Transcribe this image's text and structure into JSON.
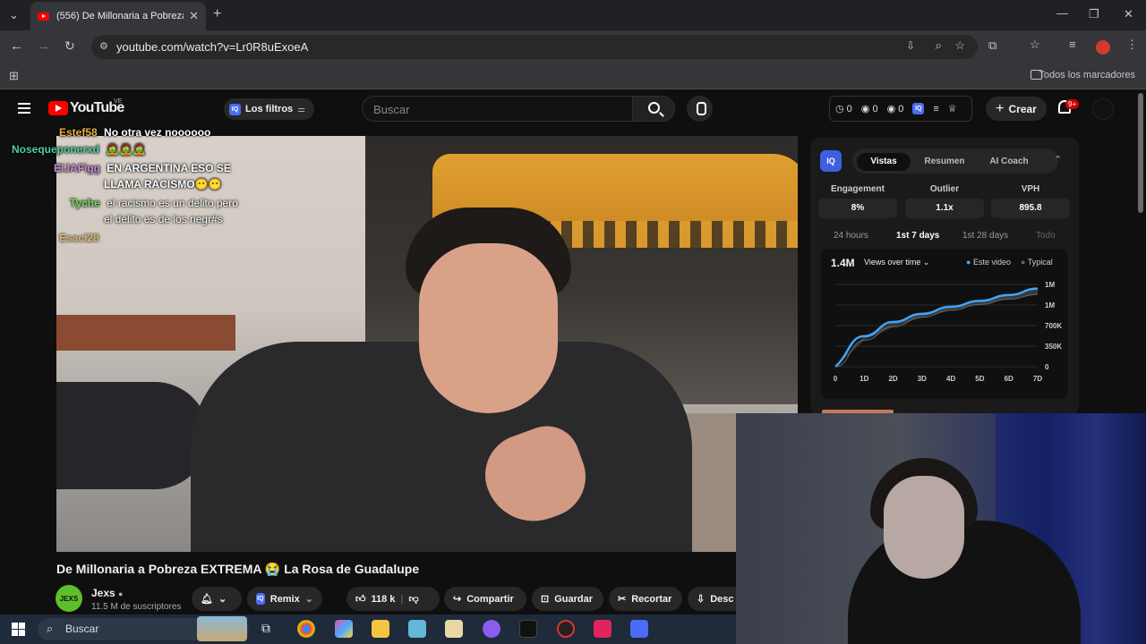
{
  "browser": {
    "tab_title": "(556) De Millonaria a Pobreza E",
    "url": "youtube.com/watch?v=Lr0R8uExoeA",
    "bookmarks_label": "Todos los marcadores"
  },
  "youtube": {
    "logo_text": "YouTube",
    "region": "VE",
    "filters_label": "Los filtros",
    "search_placeholder": "Buscar",
    "stats": [
      "0",
      "0",
      "0"
    ],
    "create_label": "Crear",
    "notifications_badge": "9+"
  },
  "chat": [
    {
      "user": "Estef58",
      "msg": "No otra vez noooooo",
      "user_color": "#e2b04a"
    },
    {
      "user": "Nosequeponerxd",
      "msg": "🧟🧟🧟",
      "user_color": "#4ed0a0"
    },
    {
      "user": "ElJAFigg",
      "msg": "EN ARGENTINA ESO SE",
      "msg2": "LLAMA RACISMO😶😶",
      "user_color": "#c88ad8"
    },
    {
      "user": "Tyche",
      "msg": "el racismo es un delito pero",
      "msg2": "el delito es de los negr#s",
      "user_color": "#7adf5a"
    },
    {
      "user": "Esaci28",
      "msg": "",
      "user_color": "#e2b04a"
    }
  ],
  "video": {
    "title": "De Millonaria a Pobreza EXTREMA 😭 La Rosa de Guadalupe",
    "channel": "Jexs",
    "channel_avatar_text": "JEXS",
    "subscribers": "11.5 M de suscriptores",
    "remix_label": "Remix",
    "likes": "118 k",
    "share_label": "Compartir",
    "save_label": "Guardar",
    "clip_label": "Recortar",
    "download_label": "Desc"
  },
  "iq_panel": {
    "logo": "IQ",
    "tabs": [
      "Vistas",
      "Resumen",
      "AI Coach"
    ],
    "active_tab": "Vistas",
    "metrics": [
      {
        "label": "Engagement",
        "value": "8%"
      },
      {
        "label": "Outlier",
        "value": "1.1x"
      },
      {
        "label": "VPH",
        "value": "895.8"
      }
    ],
    "ranges": [
      "24 hours",
      "1st 7 days",
      "1st 28 days",
      "Todo"
    ],
    "active_range": "1st 7 days",
    "total_views": "1.4M",
    "views_dropdown": "Views over time",
    "legend_this": "Este video",
    "legend_typical": "Typical"
  },
  "chart_data": {
    "type": "line",
    "x": [
      "0",
      "1D",
      "2D",
      "3D",
      "4D",
      "5D",
      "6D",
      "7D"
    ],
    "y_tick_labels": [
      "0",
      "350K",
      "700K",
      "1M",
      "1M"
    ],
    "ylim": [
      0,
      1400000
    ],
    "series": [
      {
        "name": "Este video",
        "color": "#3ea6ff",
        "values": [
          0,
          520000,
          760000,
          900000,
          1020000,
          1120000,
          1220000,
          1330000
        ]
      },
      {
        "name": "Typical",
        "color": "#666666",
        "values": [
          0,
          450000,
          680000,
          840000,
          960000,
          1060000,
          1150000,
          1230000
        ]
      }
    ]
  },
  "taskbar": {
    "search_label": "Buscar"
  }
}
